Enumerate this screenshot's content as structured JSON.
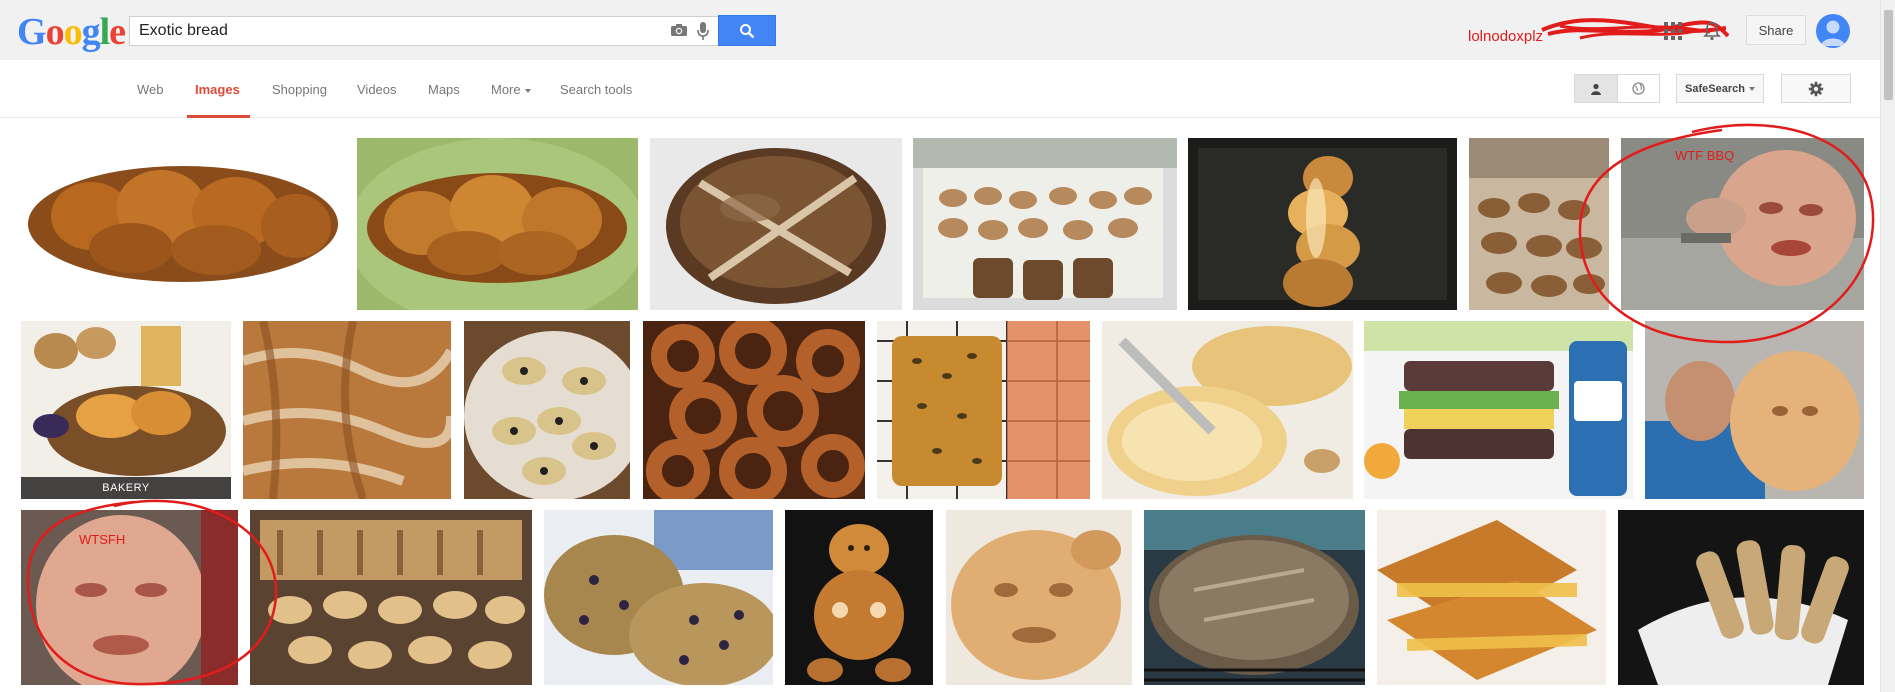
{
  "logo": {
    "letters": [
      "G",
      "o",
      "o",
      "g",
      "l",
      "e"
    ]
  },
  "search": {
    "query": "Exotic bread"
  },
  "header": {
    "user_label": "lolnodoxplz",
    "share_label": "Share"
  },
  "nav": {
    "tabs": [
      "Web",
      "Images",
      "Shopping",
      "Videos",
      "Maps",
      "More",
      "Search tools"
    ],
    "active_tab": "Images",
    "safesearch_label": "SafeSearch"
  },
  "results": {
    "rows": [
      [
        {
          "icon": "braided-challah-image"
        },
        {
          "icon": "challah-on-green-plate-image"
        },
        {
          "icon": "round-loaf-image"
        },
        {
          "icon": "bakery-display-image"
        },
        {
          "icon": "glowing-braid-image"
        },
        {
          "icon": "bread-table-image"
        },
        {
          "icon": "face-image"
        }
      ],
      [
        {
          "icon": "bakery-basket-image",
          "label": "BAKERY"
        },
        {
          "icon": "crusty-texture-image"
        },
        {
          "icon": "topped-flatbread-image"
        },
        {
          "icon": "simit-rings-image"
        },
        {
          "icon": "seeded-loaf-image"
        },
        {
          "icon": "sliced-loaf-image"
        },
        {
          "icon": "gluten-free-sandwich-image"
        },
        {
          "icon": "face-bread-person-image"
        }
      ],
      [
        {
          "icon": "face-image"
        },
        {
          "icon": "bread-stall-image"
        },
        {
          "icon": "blueberry-bread-image"
        },
        {
          "icon": "doll-bread-image"
        },
        {
          "icon": "face-bread-image"
        },
        {
          "icon": "dark-loaf-image"
        },
        {
          "icon": "cheese-toast-image"
        },
        {
          "icon": "bread-basket-image"
        }
      ]
    ]
  },
  "annotations": {
    "first": "WTF BBQ",
    "second": "WTSFH",
    "color": "#e21b1b"
  },
  "colors": {
    "active_tab": "#dd4b39",
    "search_button": "#4285f4",
    "annotation": "#e21b1b"
  }
}
